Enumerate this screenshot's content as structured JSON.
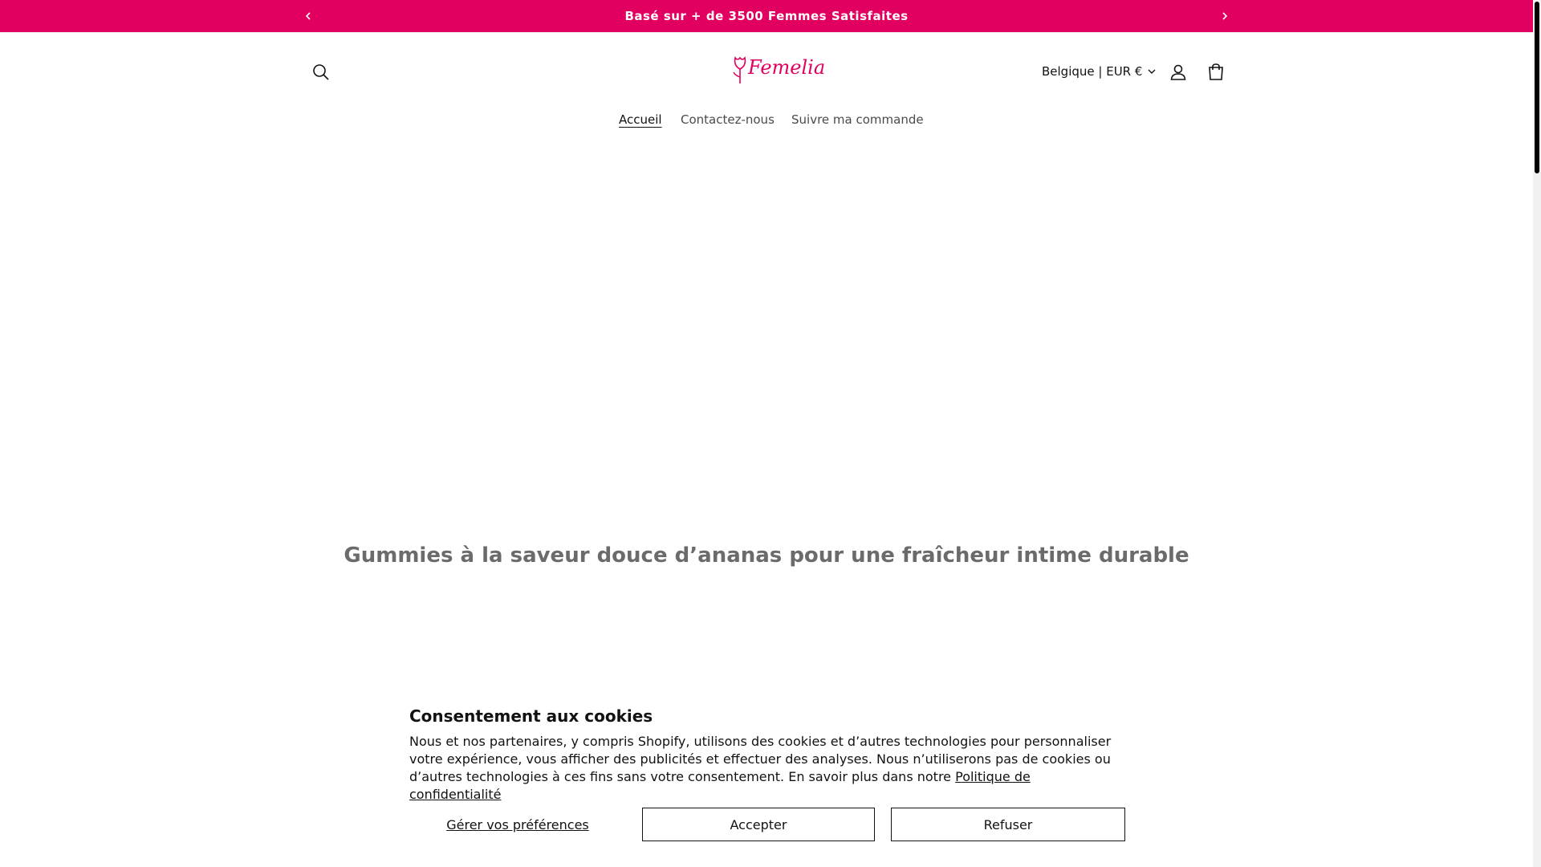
{
  "announcement": {
    "text": "Basé sur + de 3500 Femmes Satisfaites",
    "prev_icon": "chevron-left-icon",
    "next_icon": "chevron-right-icon",
    "background": "#e1005f"
  },
  "header": {
    "logo_text": "Femelia",
    "country_selector": "Belgique | EUR €",
    "icons": [
      "search-icon",
      "chevron-down-icon",
      "account-icon",
      "cart-icon"
    ]
  },
  "nav": {
    "items": [
      {
        "label": "Accueil",
        "active": true
      },
      {
        "label": "Contactez-nous",
        "active": false
      },
      {
        "label": "Suivre ma commande",
        "active": false
      }
    ]
  },
  "main": {
    "headline": "Gummies à la saveur douce d’ananas pour une fraîcheur intime durable"
  },
  "cookie_banner": {
    "title": "Consentement aux cookies",
    "body": "Nous et nos partenaires, y compris Shopify, utilisons des cookies et d’autres technologies pour personnaliser votre expérience, vous afficher des publicités et effectuer des analyses. Nous n’utiliserons pas de cookies ou d’autres technologies à ces fins sans votre consentement. En savoir plus dans notre",
    "privacy_link": "Politique de confidentialité",
    "manage_label": "Gérer vos préférences",
    "accept_label": "Accepter",
    "decline_label": "Refuser"
  }
}
